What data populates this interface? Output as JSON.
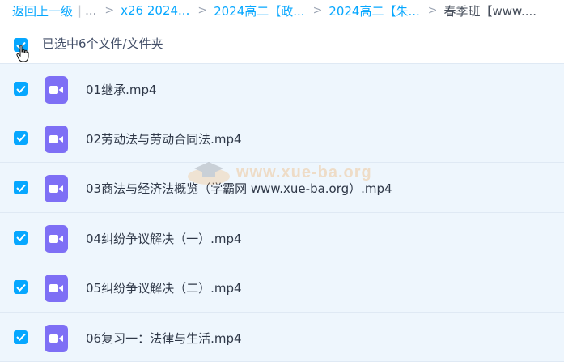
{
  "breadcrumb": {
    "back_label": "返回上一级",
    "separator": "|",
    "ellipsis": "...",
    "chevron": ">",
    "crumbs": [
      "x26 2024...",
      "2024高二【政...",
      "2024高二【朱..."
    ],
    "current": "春季班【www...."
  },
  "selection": {
    "text": "已选中6个文件/文件夹"
  },
  "files": [
    {
      "name": "01继承.mp4"
    },
    {
      "name": "02劳动法与劳动合同法.mp4"
    },
    {
      "name": "03商法与经济法概览（学霸网 www.xue-ba.org）.mp4"
    },
    {
      "name": "04纠纷争议解决（一）.mp4"
    },
    {
      "name": "05纠纷争议解决（二）.mp4"
    },
    {
      "name": "06复习一：法律与生活.mp4"
    }
  ],
  "watermark": {
    "text": "www.xue-ba.org",
    "icon": "graduation-cap-icon"
  },
  "colors": {
    "accent": "#06a7ff",
    "video_icon": "#7e6ff5",
    "row_bg": "#eef6fd",
    "watermark": "#f19a3e"
  }
}
